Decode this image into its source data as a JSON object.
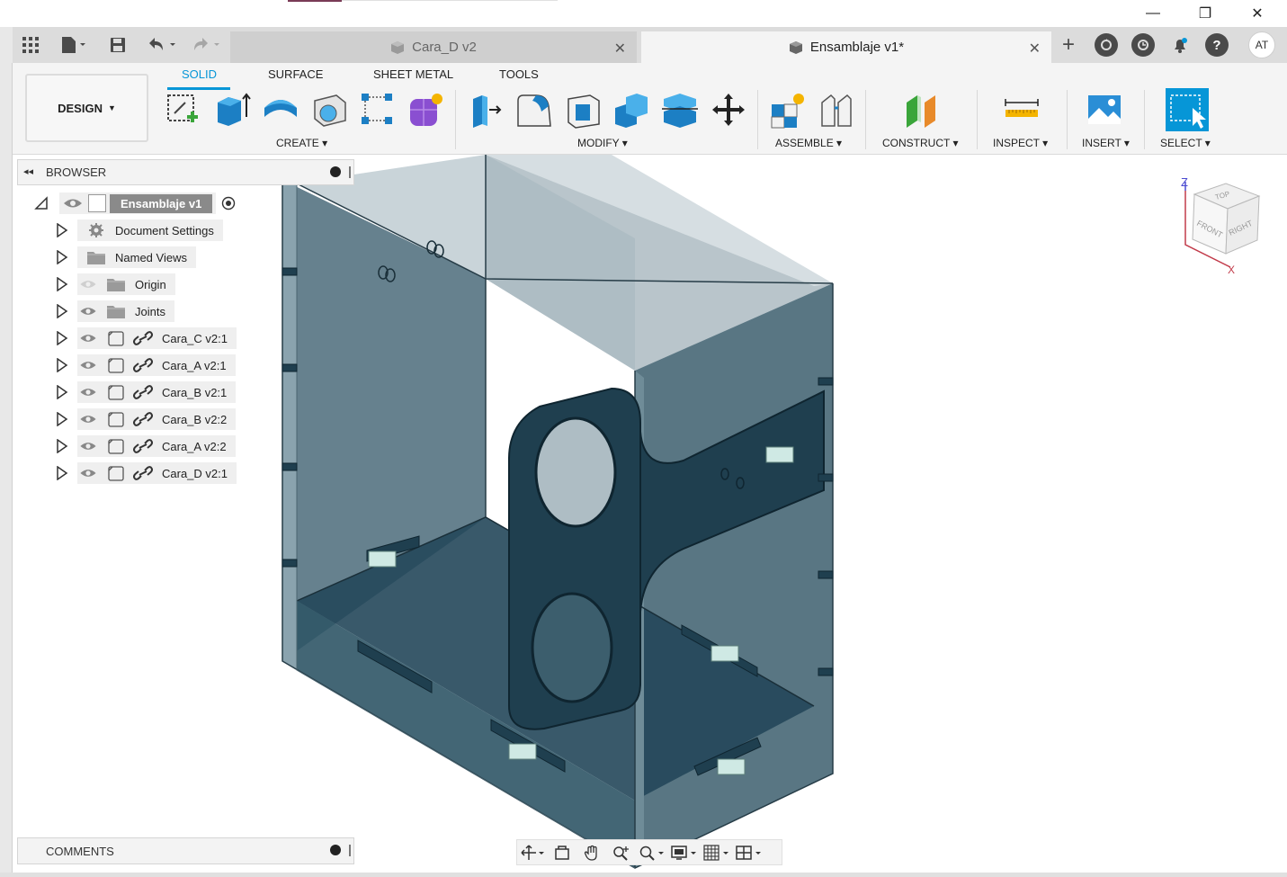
{
  "window": {
    "minimize": "—",
    "restore": "❐",
    "close": "✕"
  },
  "tabs": [
    {
      "label": "Cara_D v2",
      "active": false
    },
    {
      "label": "Ensamblaje v1*",
      "active": true
    }
  ],
  "user": {
    "initials": "AT"
  },
  "ribbon": {
    "workspace": "DESIGN",
    "tabs": [
      "SOLID",
      "SURFACE",
      "SHEET METAL",
      "TOOLS"
    ],
    "active_tab": "SOLID",
    "groups": [
      "CREATE",
      "MODIFY",
      "ASSEMBLE",
      "CONSTRUCT",
      "INSPECT",
      "INSERT",
      "SELECT"
    ]
  },
  "browser": {
    "title": "BROWSER",
    "root": "Ensamblaje v1",
    "items": [
      {
        "label": "Document Settings",
        "icon": "gear-icon"
      },
      {
        "label": "Named Views",
        "icon": "folder-icon"
      },
      {
        "label": "Origin",
        "icon": "folder-icon",
        "hidden": true
      },
      {
        "label": "Joints",
        "icon": "folder-icon"
      },
      {
        "label": "Cara_C v2:1",
        "icon": "component-icon"
      },
      {
        "label": "Cara_A v2:1",
        "icon": "component-icon"
      },
      {
        "label": "Cara_B v2:1",
        "icon": "component-icon"
      },
      {
        "label": "Cara_B v2:2",
        "icon": "component-icon"
      },
      {
        "label": "Cara_A v2:2",
        "icon": "component-icon"
      },
      {
        "label": "Cara_D v2:1",
        "icon": "component-icon"
      }
    ]
  },
  "comments": {
    "title": "COMMENTS"
  },
  "viewcube": {
    "top": "TOP",
    "front": "FRONT",
    "right": "RIGHT",
    "z": "Z",
    "x": "X"
  },
  "colors": {
    "accent": "#0696d7",
    "model": "#2f5566"
  }
}
